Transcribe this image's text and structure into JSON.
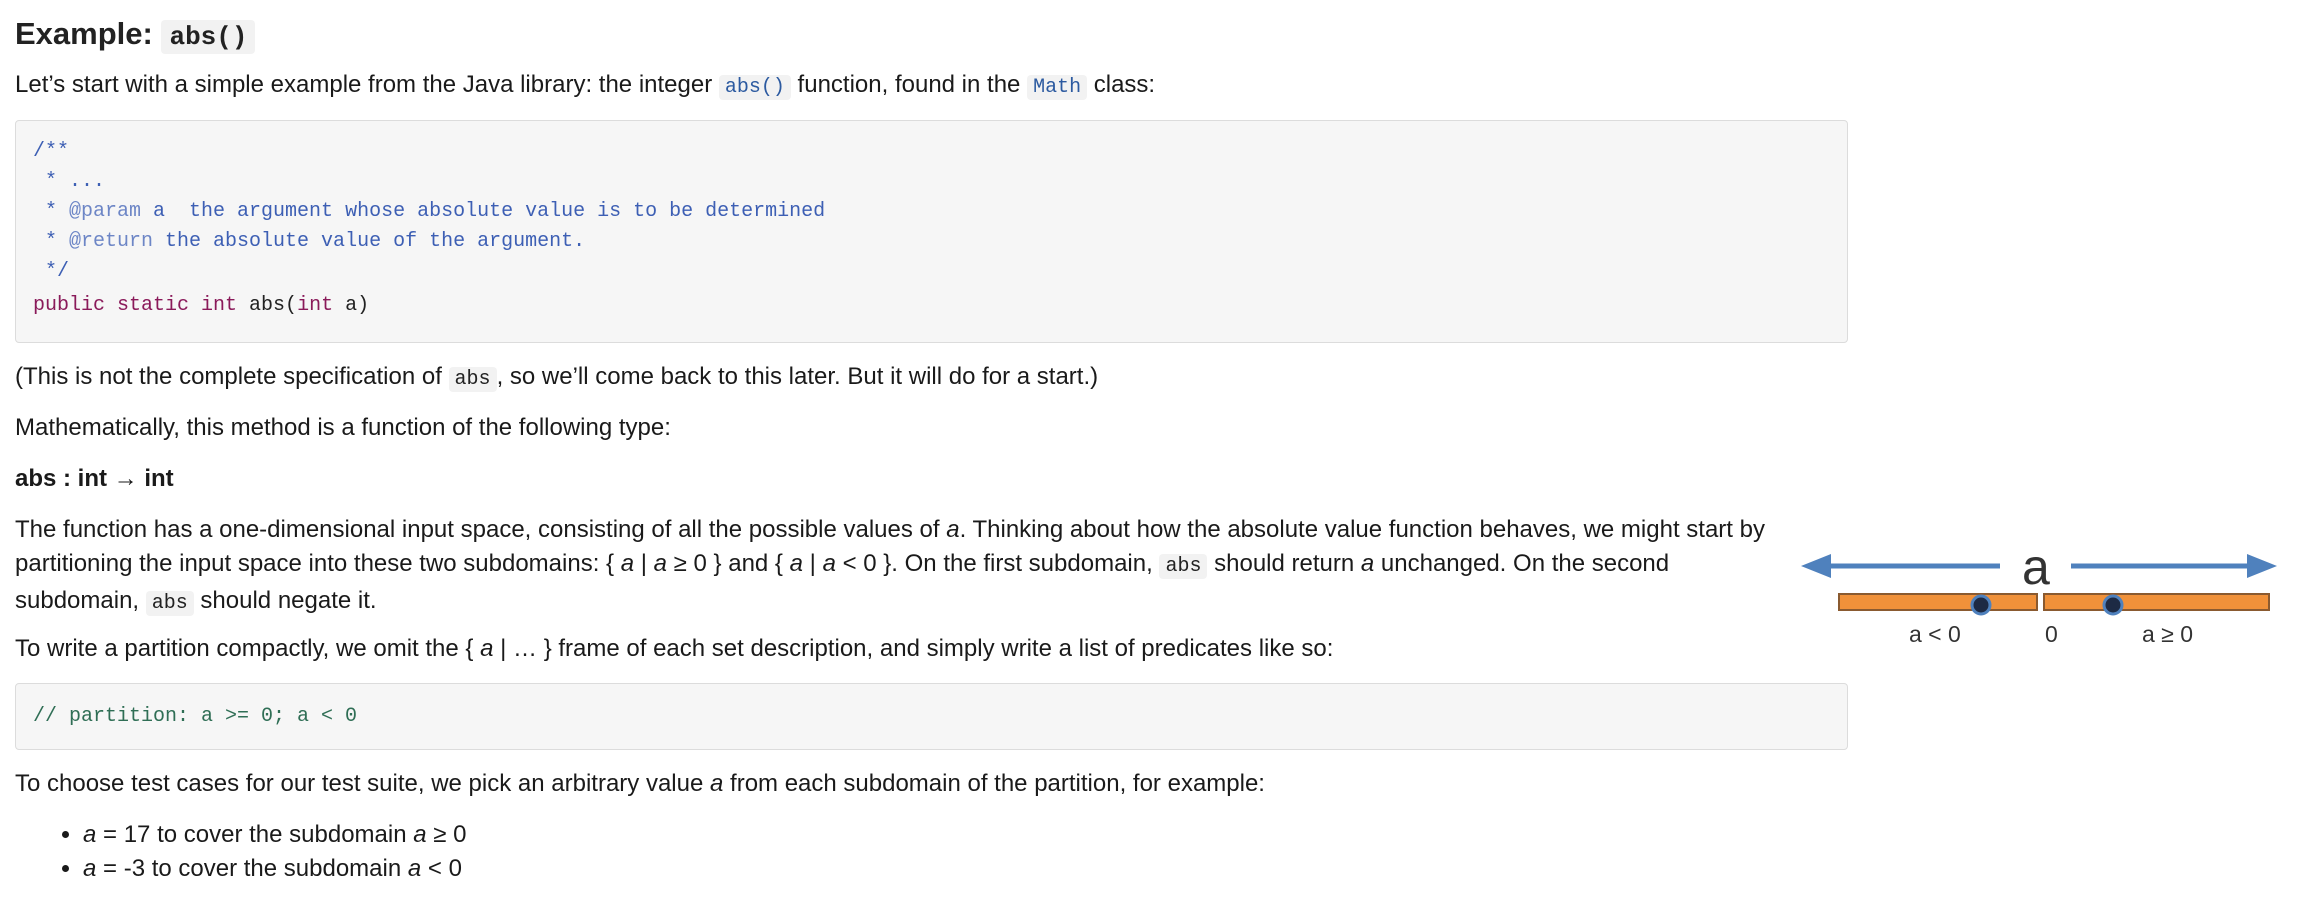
{
  "heading": {
    "prefix": "Example:",
    "code": "abs()"
  },
  "intro": {
    "before": "Let’s start with a simple example from the Java library: the integer ",
    "code1": "abs()",
    "middle": " function, found in the ",
    "code2": "Math",
    "after": " class:"
  },
  "code_spec": {
    "l1": "/**",
    "l2": " * ...",
    "l3_pre": " * ",
    "l3_tag": "@param",
    "l3_rest": " a  the argument whose absolute value is to be determined",
    "l4_pre": " * ",
    "l4_tag": "@return",
    "l4_rest": " the absolute value of the argument.",
    "l5": " */",
    "l6_kw": "public static int",
    "l6_mid": " abs(",
    "l6_kw2": "int",
    "l6_end": " a)"
  },
  "note": {
    "before": "(This is not the complete specification of ",
    "code": "abs",
    "after": ", so we’ll come back to this later. But it will do for a start.)"
  },
  "math_intro": "Mathematically, this method is a function of the following type:",
  "signature": "abs : int → int",
  "partition_para": {
    "line1_a": "The function has a one-dimensional input space, consisting of all the possible values of ",
    "line1_var": "a",
    "line1_b": ". Thinking about how the absolute value function behaves, we might start by",
    "line2_a": "partitioning the input space into these two subdomains: { ",
    "line2_v1": "a",
    "line2_b": " | ",
    "line2_v2": "a",
    "line2_c": " ≥ 0 } and { ",
    "line2_v3": "a",
    "line2_d": " | ",
    "line2_v4": "a",
    "line2_e": " < 0 }. On the first subdomain, ",
    "line2_code": "abs",
    "line2_f": " should return ",
    "line2_v5": "a",
    "line2_g": " unchanged. On the second",
    "line3_a": "subdomain, ",
    "line3_code": "abs",
    "line3_b": " should negate it."
  },
  "compact_para": {
    "a": "To write a partition compactly, we omit the { ",
    "v": "a",
    "b": " | … } frame of each set description, and simply write a list of predicates like so:"
  },
  "code_partition": "// partition: a >= 0; a < 0",
  "testcase_para": {
    "a": "To choose test cases for our test suite, we pick an arbitrary value ",
    "v": "a",
    "b": " from each subdomain of the partition, for example:"
  },
  "list": [
    {
      "var": "a",
      "text": " = 17 to cover the subdomain ",
      "var2": "a",
      "cond": " ≥ 0"
    },
    {
      "var": "a",
      "text": " = -3 to cover the subdomain ",
      "var2": "a",
      "cond": " < 0"
    }
  ],
  "diagram": {
    "var_label": "a",
    "left_label": "a < 0",
    "zero_label": "0",
    "right_label": "a ≥ 0",
    "arrow_color": "#4f81bd",
    "bar_color": "#f0913a"
  }
}
